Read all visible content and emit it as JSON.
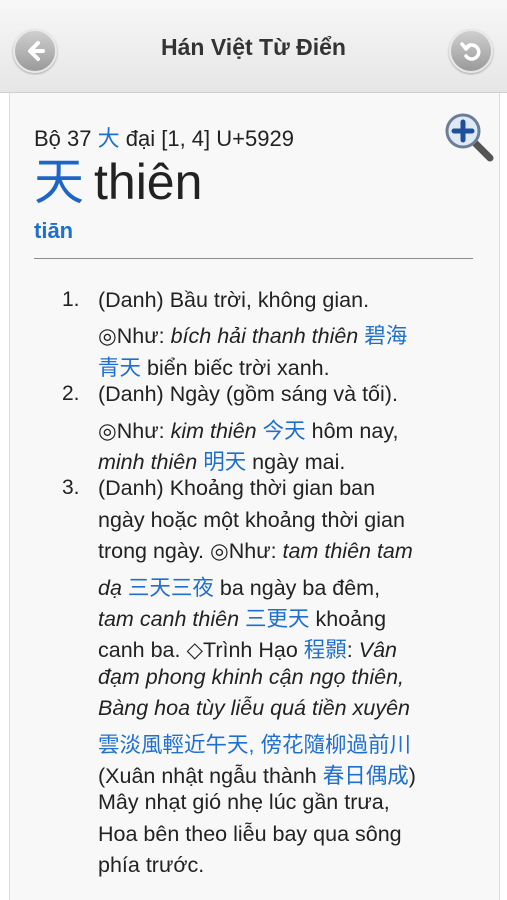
{
  "nav": {
    "title": "Hán Việt Từ Điển",
    "back_icon": "arrow-left-icon",
    "undo_icon": "undo-icon"
  },
  "entry": {
    "radical_prefix": "Bộ 37",
    "radical_char": "大",
    "radical_rest": "đại [1, 4] U+5929",
    "char": "天",
    "reading": "thiên",
    "pinyin": "tiān"
  },
  "definitions": [
    {
      "num": "1.",
      "lines": [
        [
          {
            "t": "(Danh) Bầu trời, không gian."
          }
        ],
        [
          {
            "t": "◎Như: "
          },
          {
            "t": "bích hải thanh thiên",
            "s": "i"
          },
          {
            "t": " "
          },
          {
            "t": "碧海",
            "s": "c"
          }
        ],
        [
          {
            "t": "青天",
            "s": "c"
          },
          {
            "t": " biển biếc trời xanh."
          }
        ]
      ]
    },
    {
      "num": "2.",
      "lines": [
        [
          {
            "t": "(Danh) Ngày (gồm sáng và tối)."
          }
        ],
        [
          {
            "t": "◎Như: "
          },
          {
            "t": "kim thiên",
            "s": "i"
          },
          {
            "t": " "
          },
          {
            "t": "今天",
            "s": "c"
          },
          {
            "t": " hôm nay,"
          }
        ],
        [
          {
            "t": "minh thiên",
            "s": "i"
          },
          {
            "t": " "
          },
          {
            "t": "明天",
            "s": "c"
          },
          {
            "t": " ngày mai."
          }
        ]
      ]
    },
    {
      "num": "3.",
      "lines": [
        [
          {
            "t": "(Danh) Khoảng thời gian ban"
          }
        ],
        [
          {
            "t": "ngày hoặc một khoảng thời gian"
          }
        ],
        [
          {
            "t": "trong ngày. ◎Như: "
          },
          {
            "t": "tam thiên tam",
            "s": "i"
          }
        ],
        [
          {
            "t": "dạ",
            "s": "i"
          },
          {
            "t": " "
          },
          {
            "t": "三天三夜",
            "s": "c"
          },
          {
            "t": " ba ngày ba đêm,"
          }
        ],
        [
          {
            "t": "tam canh thiên",
            "s": "i"
          },
          {
            "t": " "
          },
          {
            "t": "三更天",
            "s": "c"
          },
          {
            "t": " khoảng"
          }
        ],
        [
          {
            "t": "canh ba. ◇Trình Hạo "
          },
          {
            "t": "程顥",
            "s": "c"
          },
          {
            "t": ": "
          },
          {
            "t": "Vân",
            "s": "i"
          }
        ],
        [
          {
            "t": "đạm phong khinh cận ngọ thiên,",
            "s": "i"
          }
        ],
        [
          {
            "t": "Bàng hoa tùy liễu quá tiền xuyên",
            "s": "i"
          }
        ],
        [
          {
            "t": "雲淡風輕近午天, 傍花隨柳過前川",
            "s": "c"
          }
        ],
        [
          {
            "t": "(Xuân nhật ngẫu thành "
          },
          {
            "t": "春日偶成",
            "s": "c"
          },
          {
            "t": ")"
          }
        ],
        [
          {
            "t": "Mây nhạt gió nhẹ lúc gần trưa,"
          }
        ],
        [
          {
            "t": "Hoa bên theo liễu bay qua sông"
          }
        ],
        [
          {
            "t": "phía trước."
          }
        ]
      ]
    }
  ]
}
